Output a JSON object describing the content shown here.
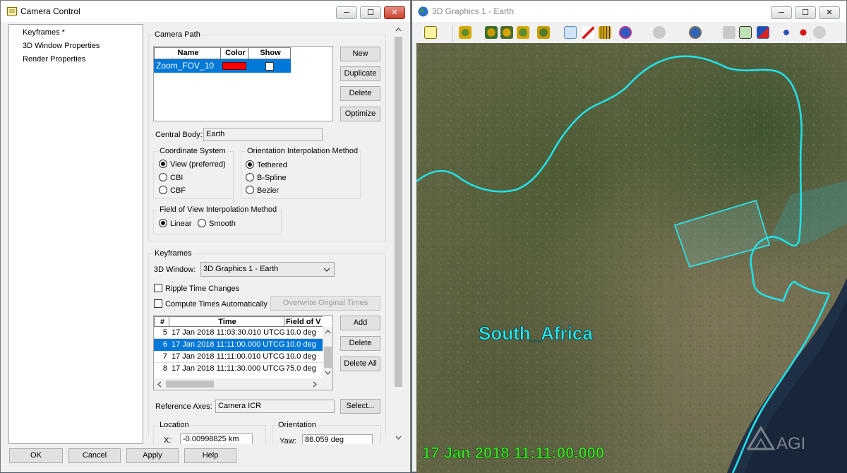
{
  "camera_window": {
    "title": "Camera Control",
    "minimize": "─",
    "maximize": "☐",
    "close": "✕",
    "tree": [
      "Keyframes *",
      "3D Window Properties",
      "Render Properties"
    ],
    "camera_path": {
      "title": "Camera Path",
      "columns": [
        "Name",
        "Color",
        "Show"
      ],
      "row": {
        "name": "Zoom_FOV_10",
        "color": "#ff0000"
      },
      "buttons": [
        "New",
        "Duplicate",
        "Delete",
        "Optimize"
      ]
    },
    "central_body": {
      "label": "Central Body:",
      "value": "Earth"
    },
    "coordinate_system": {
      "title": "Coordinate System",
      "options": [
        "View (preferred)",
        "CBI",
        "CBF"
      ]
    },
    "orientation": {
      "title": "Orientation Interpolation Method",
      "options": [
        "Tethered",
        "B-Spline",
        "Bezier"
      ]
    },
    "fov": {
      "title": "Field of View Interpolation Method",
      "options": [
        "Linear",
        "Smooth"
      ]
    },
    "keyframes": {
      "title": "Keyframes",
      "window_label": "3D Window:",
      "window_value": "3D Graphics 1 - Earth",
      "ripple": "Ripple Time Changes",
      "compute": "Compute Times Automatically",
      "overwrite": "Overwrite Original Times",
      "columns": [
        "#",
        "Time",
        "Field of V"
      ],
      "rows": [
        {
          "n": "5",
          "time": "17 Jan 2018 11:03:30.010 UTCG",
          "fov": "10.0 deg"
        },
        {
          "n": "6",
          "time": "17 Jan 2018 11:11:00.000 UTCG",
          "fov": "10.0 deg"
        },
        {
          "n": "7",
          "time": "17 Jan 2018 11:11:00.010 UTCG",
          "fov": "10.0 deg"
        },
        {
          "n": "8",
          "time": "17 Jan 2018 11:11:30.000 UTCG",
          "fov": "75.0 deg"
        }
      ],
      "buttons": [
        "Add",
        "Delete",
        "Delete All"
      ]
    },
    "reference_axes": {
      "label": "Reference Axes:",
      "value": "Camera ICR",
      "button": "Select..."
    },
    "location": {
      "title": "Location",
      "x_label": "X:",
      "x_value": "-0.00998825 km"
    },
    "orientation_fields": {
      "title": "Orientation",
      "yaw_label": "Yaw:",
      "yaw_value": "86.059 deg"
    },
    "footer_buttons": [
      "OK",
      "Cancel",
      "Apply",
      "Help"
    ]
  },
  "graphics_window": {
    "title": "3D Graphics 1 - Earth",
    "minimize": "─",
    "maximize": "☐",
    "close": "✕",
    "region_label": "South_Africa",
    "timestamp": "17 Jan 2018 11:11:00.000",
    "logo": "AGI",
    "colors": {
      "border": "#22e0e8",
      "timestamp": "#3fe12b",
      "label": "#2ee8ee"
    }
  }
}
